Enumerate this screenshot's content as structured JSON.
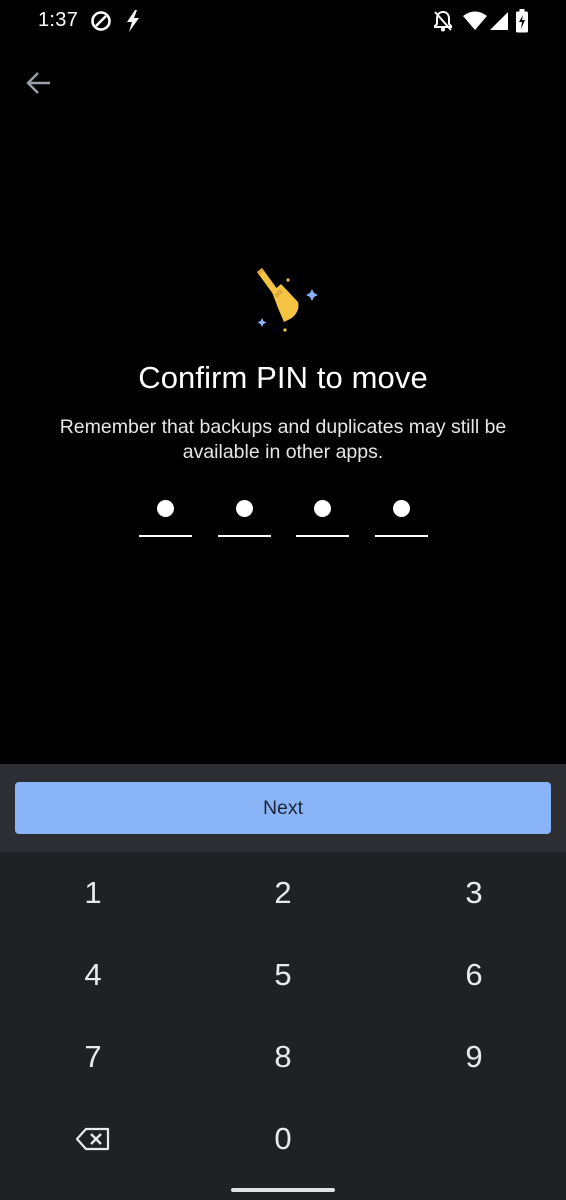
{
  "status_bar": {
    "time": "1:37",
    "icons": [
      "do-not-disturb-icon",
      "flash-icon",
      "notifications-off-icon",
      "wifi-icon",
      "cellular-signal-icon",
      "battery-charging-icon"
    ]
  },
  "header": {
    "back_icon": "arrow-back-icon"
  },
  "illustration": {
    "icon": "broom-sparkle-icon",
    "colors": {
      "handle": "#f6c443",
      "head": "#f6c443",
      "sparkle": "#8ab4f8"
    }
  },
  "main": {
    "title": "Confirm PIN to move",
    "subtitle": "Remember that backups and duplicates may still be available in other apps."
  },
  "pin": {
    "length": 4,
    "filled": 4
  },
  "actions": {
    "next_label": "Next"
  },
  "keypad": {
    "keys": [
      "1",
      "2",
      "3",
      "4",
      "5",
      "6",
      "7",
      "8",
      "9",
      "0"
    ],
    "backspace_icon": "backspace-icon"
  },
  "colors": {
    "accent": "#8ab4f8",
    "background": "#000000",
    "keypad_bg": "#202124",
    "next_bar_bg": "#2c2e33"
  }
}
